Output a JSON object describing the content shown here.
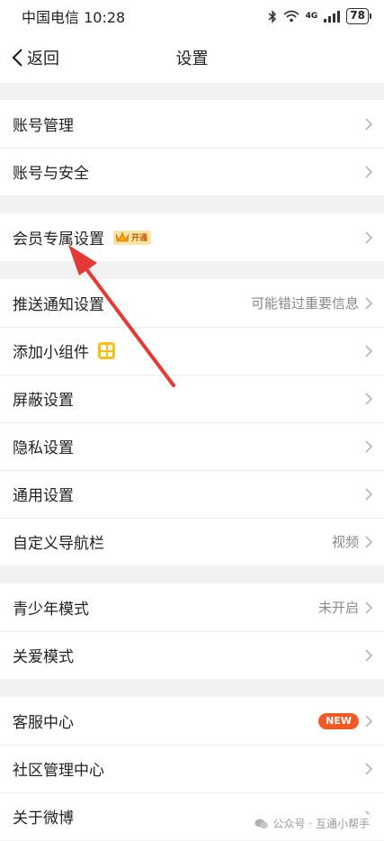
{
  "status_bar": {
    "carrier_time": "中国电信 10:28",
    "network": "4G",
    "battery": "78"
  },
  "nav": {
    "back_label": "返回",
    "title": "设置"
  },
  "groups": [
    {
      "rows": [
        {
          "label": "账号管理",
          "value": ""
        },
        {
          "label": "账号与安全",
          "value": ""
        }
      ]
    },
    {
      "rows": [
        {
          "label": "会员专属设置",
          "badge": "开通",
          "value": ""
        }
      ]
    },
    {
      "rows": [
        {
          "label": "推送通知设置",
          "value": "可能错过重要信息"
        },
        {
          "label": "添加小组件",
          "value": ""
        },
        {
          "label": "屏蔽设置",
          "value": ""
        },
        {
          "label": "隐私设置",
          "value": ""
        },
        {
          "label": "通用设置",
          "value": ""
        },
        {
          "label": "自定义导航栏",
          "value": "视频"
        }
      ]
    },
    {
      "rows": [
        {
          "label": "青少年模式",
          "value": "未开启"
        },
        {
          "label": "关爱模式",
          "value": ""
        }
      ]
    },
    {
      "rows": [
        {
          "label": "客服中心",
          "badge": "NEW",
          "value": ""
        },
        {
          "label": "社区管理中心",
          "value": ""
        },
        {
          "label": "关于微博",
          "value": ""
        }
      ]
    }
  ],
  "watermark": "公众号 · 互通小帮手",
  "colors": {
    "annotation_arrow": "#e53935",
    "new_badge": "#f15a24",
    "vip_badge_bg": "#fbe6a8",
    "widget_icon": "#f6c21a"
  }
}
